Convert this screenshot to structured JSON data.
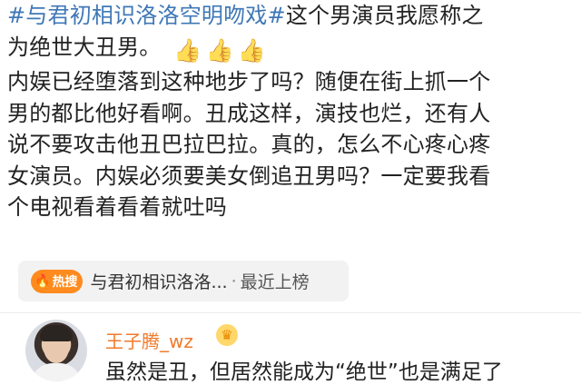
{
  "post": {
    "hashtag": "#与君初相识洛洛空明吻戏#",
    "line1_rest": "这个男演员我愿称之",
    "line2": "为绝世大丑男。",
    "body_lines": [
      "内娱已经堕落到这种地步了吗？随便在街上抓一个",
      "男的都比他好看啊。丑成这样，演技也烂，还有人",
      "说不要攻击他丑巴拉巴拉。真的，怎么不心疼心疼",
      "女演员。内娱必须要美女倒追丑男吗？一定要我看",
      "个电视看着看着就吐吗"
    ],
    "thumbs_icon": "thumbs-up-icon"
  },
  "topic": {
    "badge_label": "热搜",
    "badge_icon": "flame-icon",
    "title": "与君初相识洛洛...",
    "separator": "·",
    "status": "最近上榜"
  },
  "comment": {
    "username": "王子腾_wz",
    "badge_icon": "crown-icon",
    "text": "虽然是丑，但居然能成为“绝世”也是满足了"
  },
  "colors": {
    "hashtag": "#3f78b6",
    "username": "#f07a2a",
    "hot_badge": "#ff8a1e",
    "pill_bg": "#f2f2f2"
  }
}
